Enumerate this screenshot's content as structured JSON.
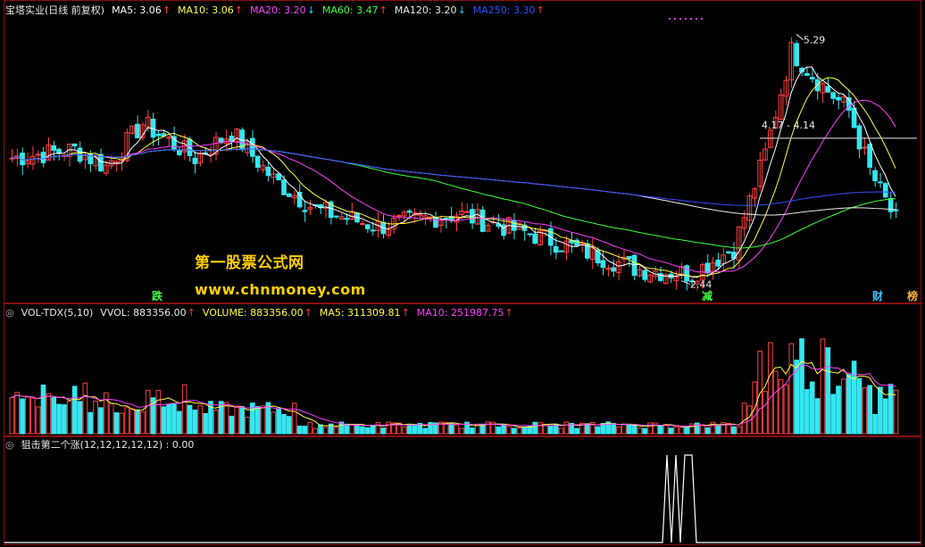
{
  "colors": {
    "background": "#000000",
    "up": "#ff4040",
    "down": "#35e6f0",
    "ma5": "#ffffff",
    "ma10": "#ffff40",
    "ma20": "#ff40ff",
    "ma60": "#40ff40",
    "ma120": "#e8e8e8",
    "ma250": "#3050ff",
    "border": "#8a0f0f",
    "watermark": "#ffd000"
  },
  "main_panel": {
    "title": "宝塔实业(日线 前复权)",
    "indicators": [
      {
        "label": "MA5: 3.06",
        "color": "#ffffff",
        "arrow": "↑",
        "dir": "up"
      },
      {
        "label": "MA10: 3.06",
        "color": "#ffff40",
        "arrow": "↑",
        "dir": "up"
      },
      {
        "label": "MA20: 3.20",
        "color": "#ff40ff",
        "arrow": "↓",
        "dir": "down"
      },
      {
        "label": "MA60: 3.47",
        "color": "#40ff40",
        "arrow": "↑",
        "dir": "up"
      },
      {
        "label": "MA120: 3.20",
        "color": "#e8e8e8",
        "arrow": "↓",
        "dir": "down"
      },
      {
        "label": "MA250: 3.30",
        "color": "#3050ff",
        "arrow": "↑",
        "dir": "up"
      }
    ],
    "high_label": "5.29",
    "low_label": "2.44",
    "range_label": "4.17 - 4.14",
    "markers": [
      {
        "text": "跌",
        "color": "#40ff40"
      },
      {
        "text": "减",
        "color": "#40ff40"
      },
      {
        "text": "财",
        "color": "#40c0ff"
      },
      {
        "text": "榜",
        "color": "#ffb040"
      }
    ]
  },
  "watermark": {
    "line1": "第一股票公式网",
    "line2": "www.chnmoney.com"
  },
  "volume_panel": {
    "indicators": [
      {
        "label": "VOL-TDX(5,10)",
        "color": "#e8e8e8",
        "arrow": "",
        "dir": ""
      },
      {
        "label": "VVOL: 883356.00",
        "color": "#e8e8e8",
        "arrow": "↑",
        "dir": "up"
      },
      {
        "label": "VOLUME: 883356.00",
        "color": "#ffff40",
        "arrow": "↑",
        "dir": "up"
      },
      {
        "label": "MA5: 311309.81",
        "color": "#ffff40",
        "arrow": "↑",
        "dir": "up"
      },
      {
        "label": "MA10: 251987.75",
        "color": "#ff40ff",
        "arrow": "↑",
        "dir": "up"
      }
    ]
  },
  "signal_panel": {
    "title": "狙击第二个涨(12,12,12,12,12) : 0.00"
  }
}
